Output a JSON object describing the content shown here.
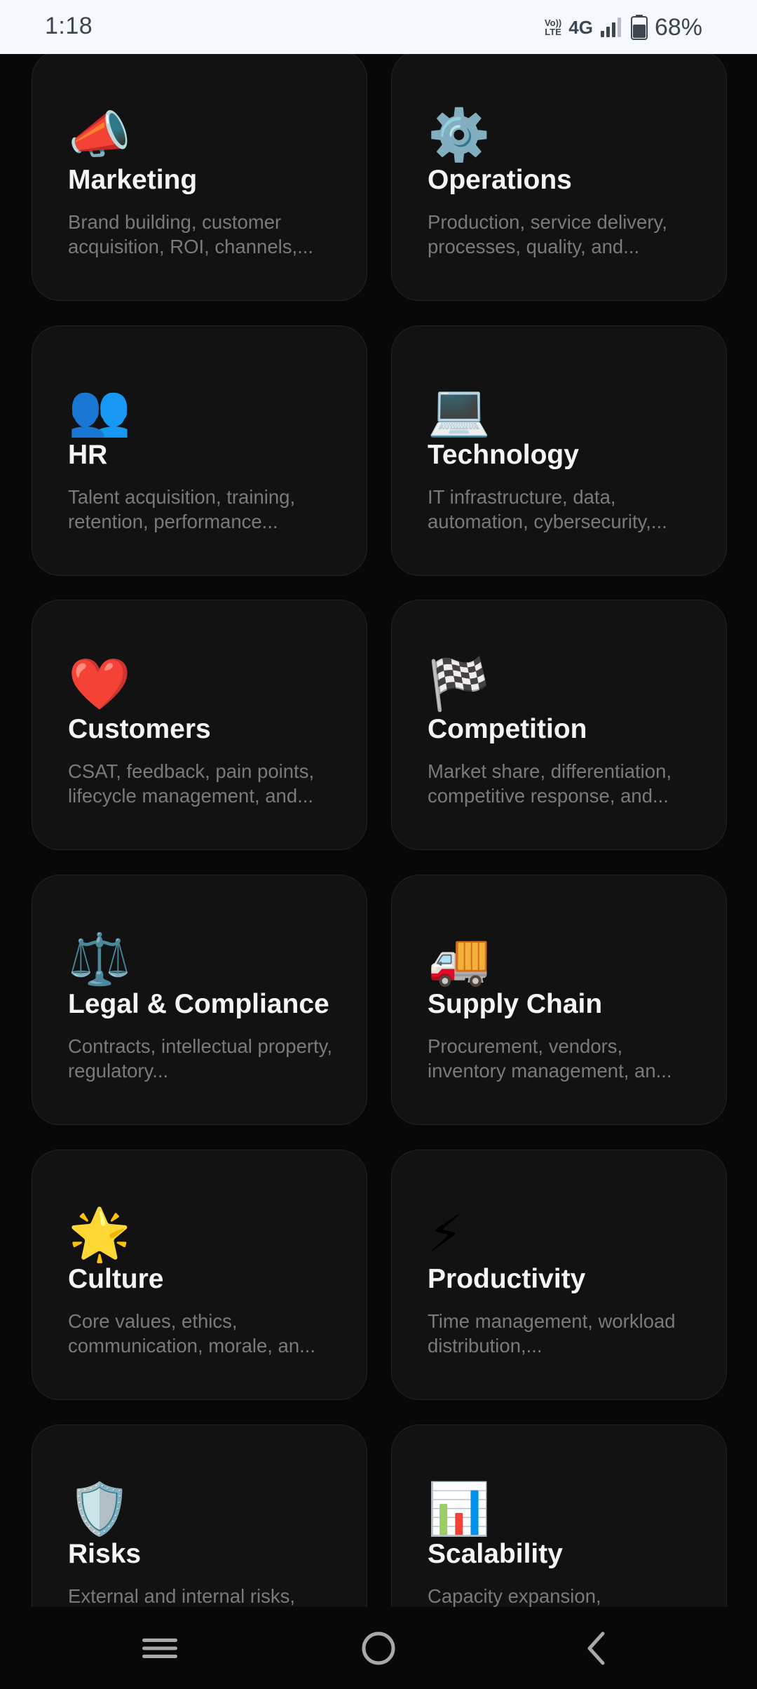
{
  "status_bar": {
    "time": "1:18",
    "volte_top": "Vo))",
    "volte_bottom": "LTE",
    "network": "4G",
    "battery_percent": "68%",
    "battery_level": 0.68,
    "icons": [
      "volte-icon",
      "signal-icon",
      "battery-icon"
    ]
  },
  "cards": [
    {
      "title": "Marketing",
      "description": "Brand building, customer acquisition, ROI, channels,...",
      "icon": "megaphone-icon",
      "emoji": "📣"
    },
    {
      "title": "Operations",
      "description": "Production, service delivery, processes, quality, and...",
      "icon": "gear-icon",
      "emoji": "⚙️"
    },
    {
      "title": "HR",
      "description": "Talent acquisition, training, retention, performance...",
      "icon": "people-icon",
      "emoji": "👥"
    },
    {
      "title": "Technology",
      "description": "IT infrastructure, data, automation, cybersecurity,...",
      "icon": "laptop-icon",
      "emoji": "💻"
    },
    {
      "title": "Customers",
      "description": "CSAT, feedback, pain points, lifecycle management, and...",
      "icon": "heart-icon",
      "emoji": "❤️"
    },
    {
      "title": "Competition",
      "description": "Market share, differentiation, competitive response, and...",
      "icon": "checkered-flag-icon",
      "emoji": "🏁"
    },
    {
      "title": "Legal & Compliance",
      "description": "Contracts, intellectual property, regulatory...",
      "icon": "scales-icon",
      "emoji": "⚖️"
    },
    {
      "title": "Supply Chain",
      "description": "Procurement, vendors, inventory management, an...",
      "icon": "delivery-truck-icon",
      "emoji": "🚚"
    },
    {
      "title": "Culture",
      "description": "Core values, ethics, communication, morale, an...",
      "icon": "star-icon",
      "emoji": "🌟"
    },
    {
      "title": "Productivity",
      "description": "Time management, workload distribution,...",
      "icon": "lightning-icon",
      "emoji": "⚡"
    },
    {
      "title": "Risks",
      "description": "External and internal risks,",
      "icon": "shield-icon",
      "emoji": "🛡️"
    },
    {
      "title": "Scalability",
      "description": "Capacity expansion,",
      "icon": "bar-chart-icon",
      "emoji": "📊"
    }
  ],
  "nav_bar": {
    "buttons": [
      "recents-icon",
      "home-icon",
      "back-icon"
    ]
  },
  "colors": {
    "background": "#080808",
    "card": "#121212",
    "card_border": "#232323",
    "title": "#f4f4f4",
    "description": "#7a7a7a",
    "status_bar": "#f5f8fd"
  }
}
